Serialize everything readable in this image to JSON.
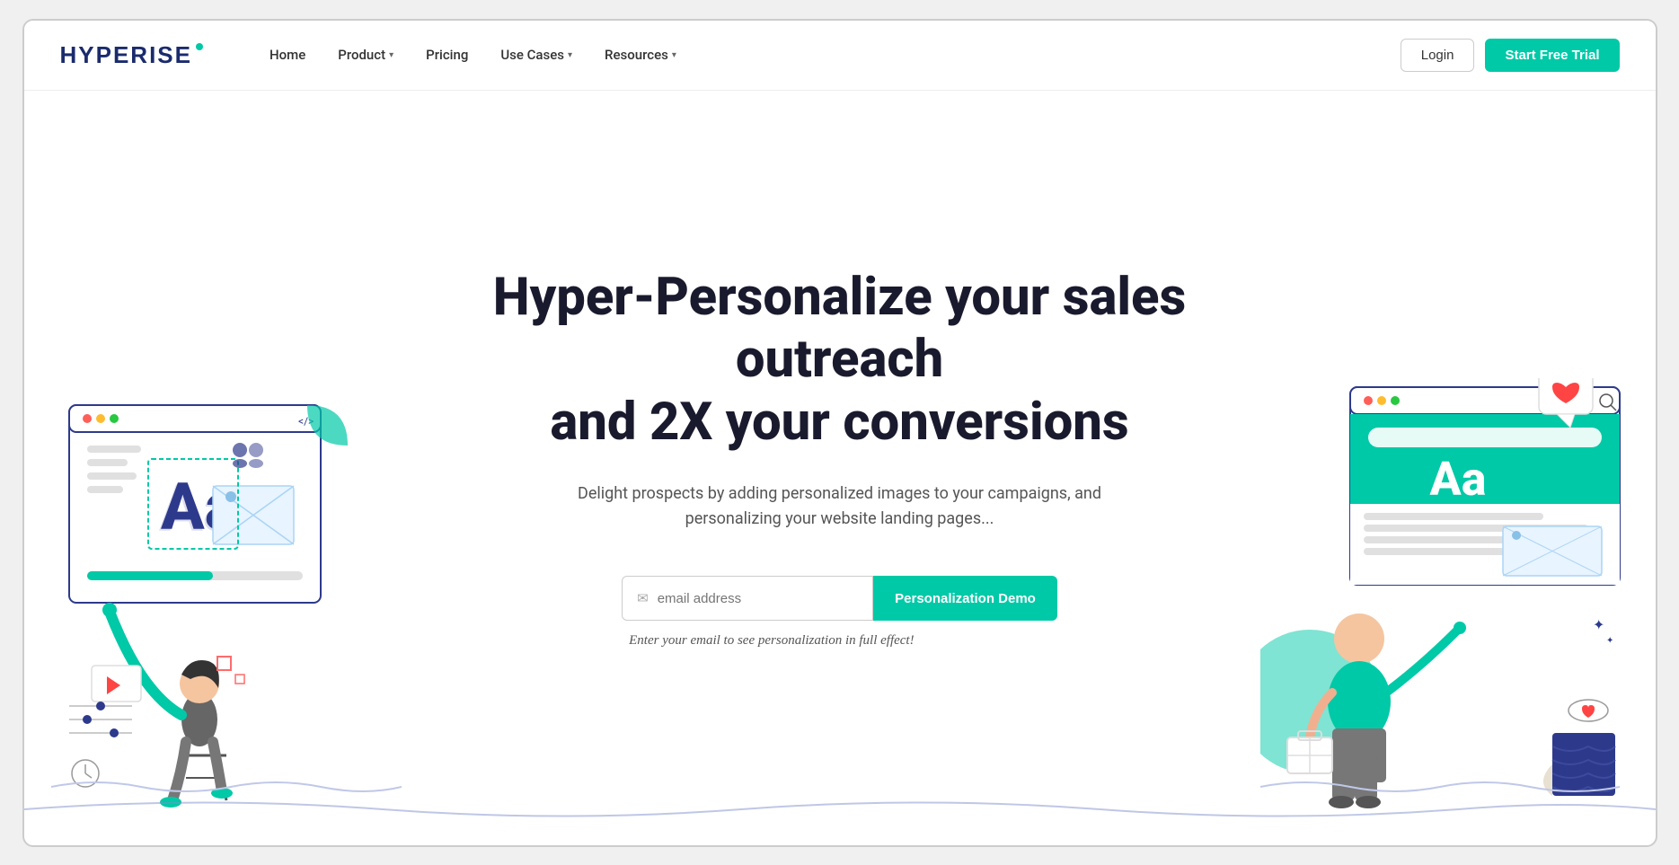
{
  "brand": {
    "name": "HYPERISE",
    "logo_dot_color": "#00c9a7"
  },
  "nav": {
    "home": "Home",
    "product": "Product",
    "pricing": "Pricing",
    "use_cases": "Use Cases",
    "resources": "Resources",
    "login": "Login",
    "start_trial": "Start Free Trial"
  },
  "hero": {
    "title_line1": "Hyper-Personalize your sales outreach",
    "title_line2": "and 2X your conversions",
    "subtitle": "Delight prospects by adding personalized images to your campaigns, and personalizing your website landing pages...",
    "email_placeholder": "email address",
    "demo_button": "Personalization Demo",
    "hint": "Enter your email to see personalization in full effect!"
  },
  "colors": {
    "teal": "#00c9a7",
    "navy": "#1a2b6d",
    "dark_text": "#1a1a2e"
  }
}
